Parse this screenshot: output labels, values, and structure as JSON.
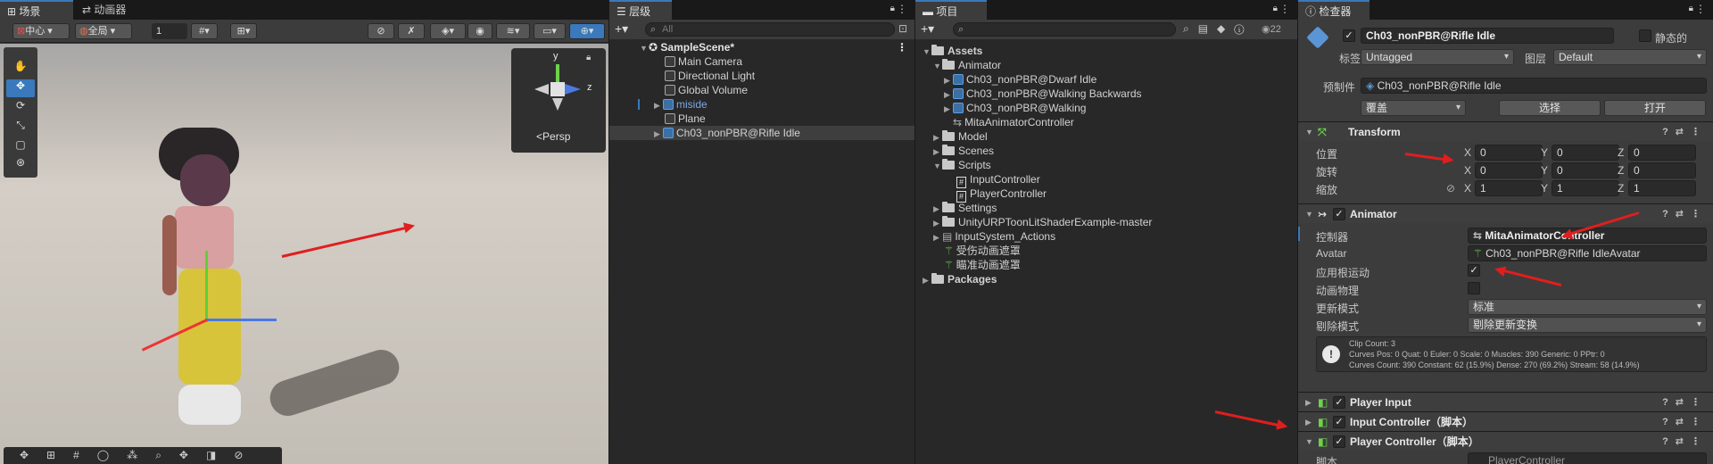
{
  "scene": {
    "tabs": [
      {
        "label": "场景",
        "active": true
      },
      {
        "label": "动画器",
        "active": false
      }
    ],
    "pivot_label": "中心",
    "space_label": "全局",
    "grid_value": "1",
    "gizmo": {
      "y": "y",
      "z": "z",
      "persp": "Persp"
    }
  },
  "hierarchy": {
    "tab": "层级",
    "search_placeholder": "All",
    "root": "SampleScene*",
    "items": [
      "Main Camera",
      "Directional Light",
      "Global Volume",
      "miside",
      "Plane",
      "Ch03_nonPBR@Rifle Idle"
    ]
  },
  "project": {
    "tab": "项目",
    "count": "22",
    "assets_label": "Assets",
    "animator_folder": "Animator",
    "animator_items": [
      "Ch03_nonPBR@Dwarf Idle",
      "Ch03_nonPBR@Walking Backwards",
      "Ch03_nonPBR@Walking",
      "MitaAnimatorController"
    ],
    "folders": [
      "Model",
      "Scenes",
      "Scripts"
    ],
    "scripts": [
      "InputController",
      "PlayerController"
    ],
    "more": [
      "Settings",
      "UnityURPToonLitShaderExample-master",
      "InputSystem_Actions",
      "受伤动画遮罩",
      "瞄准动画遮罩"
    ],
    "packages": "Packages"
  },
  "inspector": {
    "tab": "检查器",
    "object_name": "Ch03_nonPBR@Rifle Idle",
    "static_label": "静态的",
    "tag_label": "标签",
    "tag_value": "Untagged",
    "layer_label": "图层",
    "layer_value": "Default",
    "prefab_label": "预制件",
    "prefab_value": "Ch03_nonPBR@Rifle Idle",
    "override_label": "覆盖",
    "select_label": "选择",
    "open_label": "打开",
    "transform": {
      "title": "Transform",
      "position_label": "位置",
      "rotation_label": "旋转",
      "scale_label": "缩放",
      "position": [
        "0",
        "0",
        "0"
      ],
      "rotation": [
        "0",
        "0",
        "0"
      ],
      "scale": [
        "1",
        "1",
        "1"
      ],
      "axes": [
        "X",
        "Y",
        "Z"
      ]
    },
    "animator": {
      "title": "Animator",
      "controller_label": "控制器",
      "controller_value": "MitaAnimatorController",
      "avatar_label": "Avatar",
      "avatar_value": "Ch03_nonPBR@Rifle IdleAvatar",
      "root_motion_label": "应用根运动",
      "physics_label": "动画物理",
      "update_label": "更新模式",
      "update_value": "标准",
      "culling_label": "剔除模式",
      "culling_value": "剔除更新变换",
      "info_lines": [
        "Clip Count: 3",
        "Curves Pos: 0 Quat: 0 Euler: 0 Scale: 0 Muscles: 390 Generic: 0 PPtr: 0",
        "Curves Count: 390 Constant: 62 (15.9%) Dense: 270 (69.2%) Stream: 58 (14.9%)"
      ]
    },
    "components": [
      "Player Input",
      "Input Controller（脚本）",
      "Player Controller（脚本）"
    ],
    "script_label": "脚本",
    "script_value": "PlayerController"
  }
}
